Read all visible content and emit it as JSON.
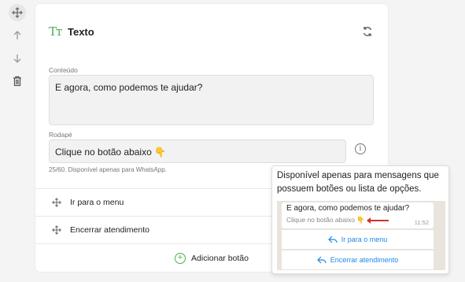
{
  "block": {
    "title": "Texto"
  },
  "content": {
    "label": "Conteúdo",
    "value": "E agora, como podemos te ajudar?"
  },
  "footer": {
    "label": "Rodapé",
    "value": "Clique no botão abaixo 👇",
    "hint": "25/60. Disponível apenas para WhatsApp."
  },
  "buttons": [
    {
      "label": "Ir para o menu"
    },
    {
      "label": "Encerrar atendimento"
    }
  ],
  "add_button_label": "Adicionar botão",
  "tooltip": {
    "text": "Disponível apenas para mensagens que possuem botões ou lista de opções.",
    "preview": {
      "message": "E agora, como podemos te ajudar?",
      "footer": "Clique no botão abaixo 👇",
      "time": "11:52",
      "buttons": [
        {
          "label": "Ir para o menu"
        },
        {
          "label": "Encerrar atendimento"
        }
      ]
    }
  },
  "colors": {
    "accent_green": "#4caf50",
    "link_blue": "#1e88e5",
    "arrow_red": "#d32f2f"
  }
}
